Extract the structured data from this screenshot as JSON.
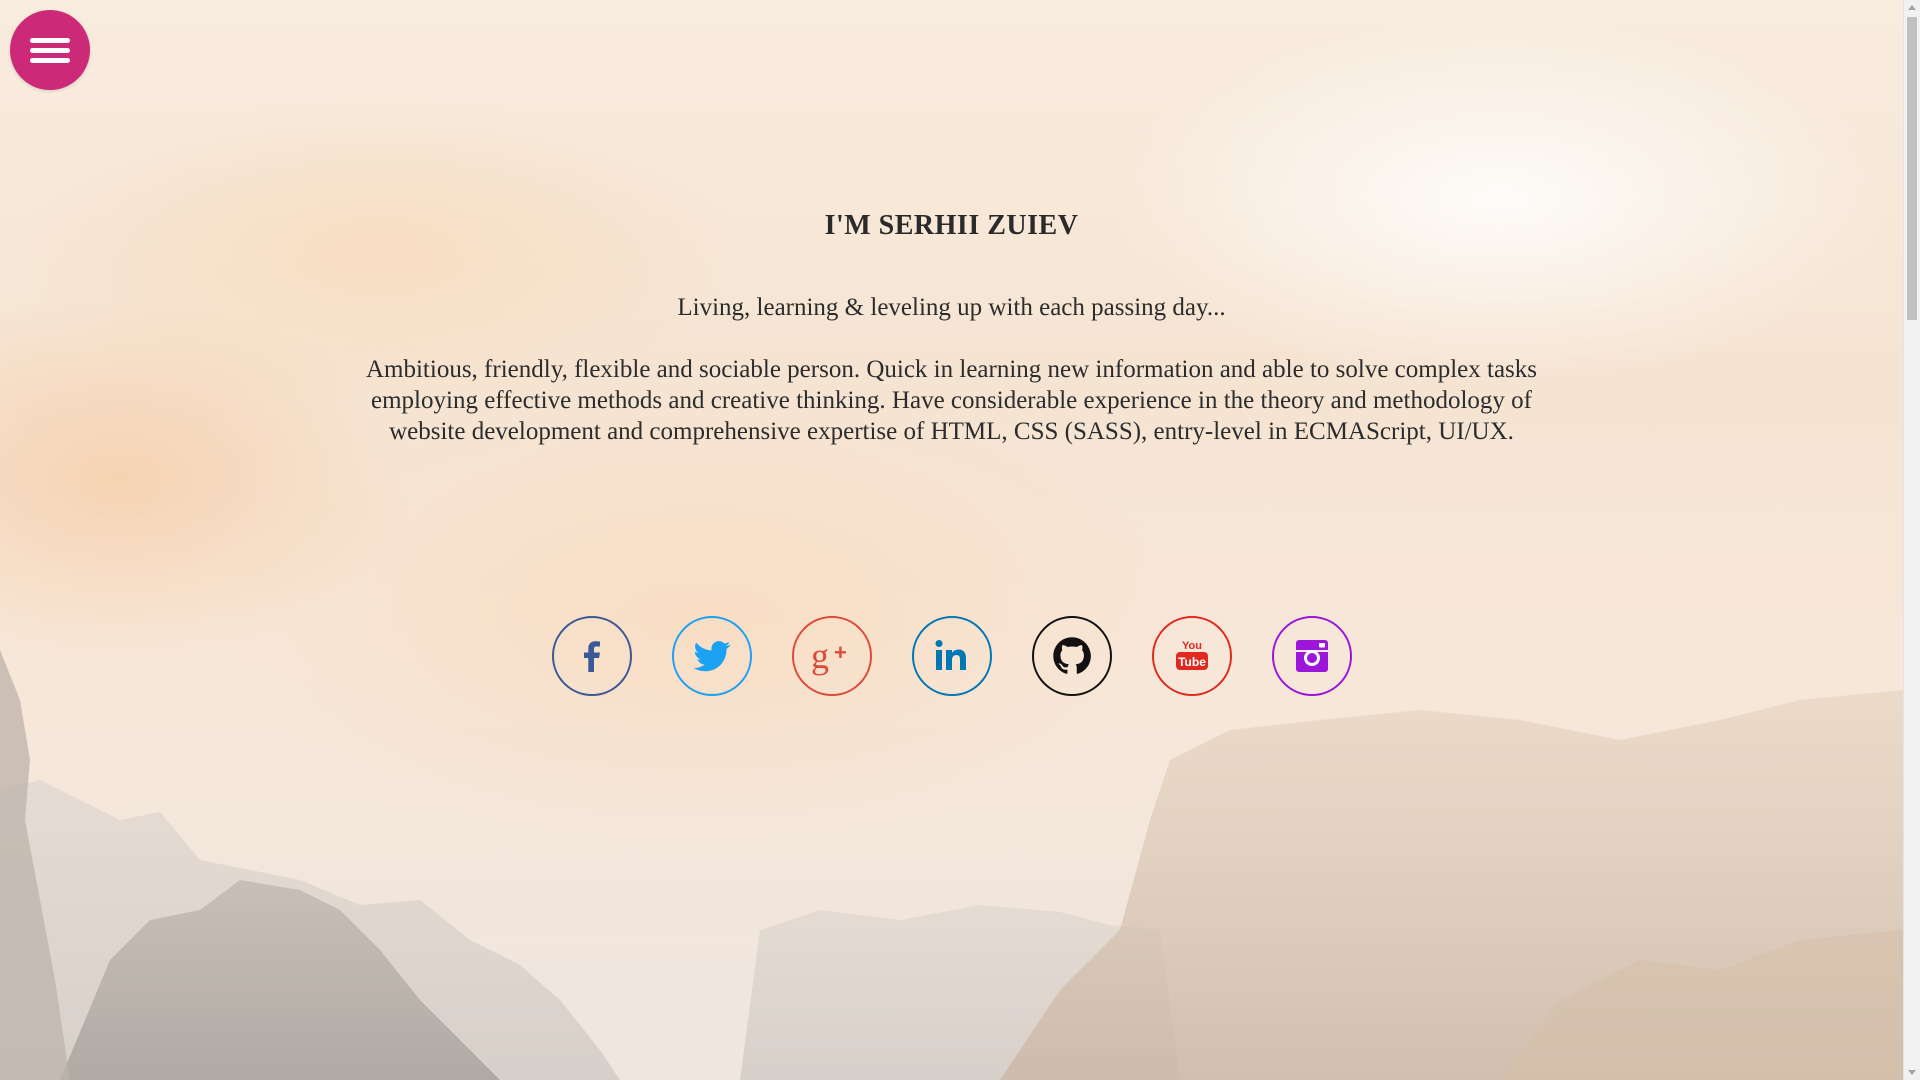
{
  "menu": {
    "icon": "hamburger-menu-icon",
    "color": "#cc2a78"
  },
  "hero": {
    "title": "I'M SERHII ZUIEV",
    "tagline": "Living, learning & leveling up with each passing day...",
    "about": "Ambitious, friendly, flexible and sociable person. Quick in learning new information and able to solve complex tasks employing effective methods and creative thinking. Have considerable experience in the theory and methodology of website development and comprehensive expertise of HTML, CSS (SASS), entry-level in ECMAScript, UI/UX."
  },
  "socials": [
    {
      "name": "facebook",
      "icon": "facebook-icon",
      "color": "#3b5998"
    },
    {
      "name": "twitter",
      "icon": "twitter-icon",
      "color": "#1da1f2"
    },
    {
      "name": "google-plus",
      "icon": "google-plus-icon",
      "color": "#dd4b39"
    },
    {
      "name": "linkedin",
      "icon": "linkedin-icon",
      "color": "#0077b5"
    },
    {
      "name": "github",
      "icon": "github-icon",
      "color": "#111111"
    },
    {
      "name": "youtube",
      "icon": "youtube-icon",
      "color": "#e02a20",
      "glyph_text": [
        "You",
        "Tube"
      ]
    },
    {
      "name": "instagram",
      "icon": "instagram-icon",
      "color": "#9b16d8"
    }
  ]
}
